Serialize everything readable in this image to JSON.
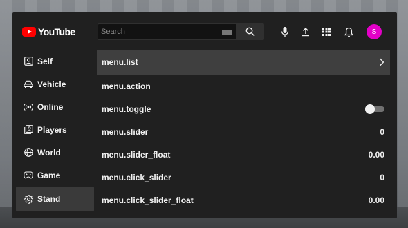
{
  "header": {
    "logo_text": "YouTube",
    "search_placeholder": "Search",
    "avatar_letter": "S"
  },
  "sidebar": {
    "items": [
      {
        "label": "Self",
        "icon": "user-square-icon",
        "active": false
      },
      {
        "label": "Vehicle",
        "icon": "car-icon",
        "active": false
      },
      {
        "label": "Online",
        "icon": "broadcast-icon",
        "active": false
      },
      {
        "label": "Players",
        "icon": "players-icon",
        "active": false
      },
      {
        "label": "World",
        "icon": "globe-icon",
        "active": false
      },
      {
        "label": "Game",
        "icon": "gamepad-icon",
        "active": false
      },
      {
        "label": "Stand",
        "icon": "gear-icon",
        "active": true
      }
    ]
  },
  "main": {
    "rows": [
      {
        "label": "menu.list",
        "value": "",
        "kind": "list"
      },
      {
        "label": "menu.action",
        "value": "",
        "kind": "action"
      },
      {
        "label": "menu.toggle",
        "value": "",
        "kind": "toggle"
      },
      {
        "label": "menu.slider",
        "value": "0",
        "kind": "slider"
      },
      {
        "label": "menu.slider_float",
        "value": "0.00",
        "kind": "slider"
      },
      {
        "label": "menu.click_slider",
        "value": "0",
        "kind": "slider"
      },
      {
        "label": "menu.click_slider_float",
        "value": "0.00",
        "kind": "slider"
      }
    ],
    "toggle_on": true
  },
  "colors": {
    "panel": "#202020",
    "logo_red": "#ff0000",
    "avatar": "#e400c8",
    "active_row": "#3f3f3f"
  }
}
